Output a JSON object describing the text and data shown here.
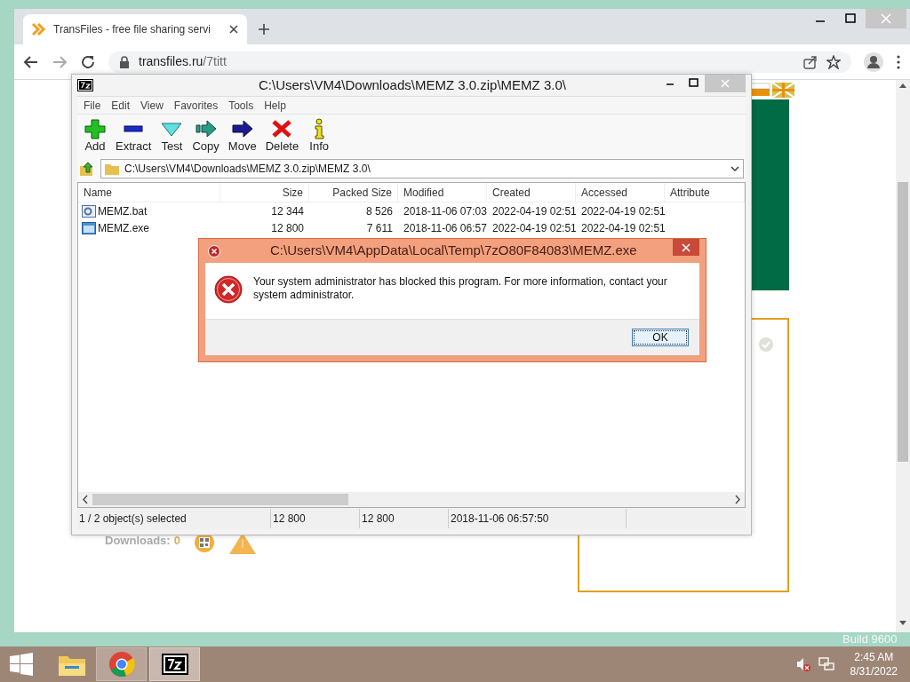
{
  "desktop": {
    "build_text": "Build 9600"
  },
  "browser": {
    "tab_title": "TransFiles - free file sharing servi",
    "url_host": "transfiles.ru",
    "url_path": "/7titt",
    "page": {
      "downloads_label": "Downloads:",
      "downloads_value": "0"
    }
  },
  "archive_window": {
    "title": "C:\\Users\\VM4\\Downloads\\MEMZ 3.0.zip\\MEMZ 3.0\\",
    "menu": [
      "File",
      "Edit",
      "View",
      "Favorites",
      "Tools",
      "Help"
    ],
    "toolbar": [
      {
        "kind": "add",
        "label": "Add"
      },
      {
        "kind": "extract",
        "label": "Extract"
      },
      {
        "kind": "test",
        "label": "Test"
      },
      {
        "kind": "copy",
        "label": "Copy"
      },
      {
        "kind": "move",
        "label": "Move"
      },
      {
        "kind": "delete",
        "label": "Delete"
      },
      {
        "kind": "info",
        "label": "Info"
      }
    ],
    "address": "C:\\Users\\VM4\\Downloads\\MEMZ 3.0.zip\\MEMZ 3.0\\",
    "columns": [
      "Name",
      "Size",
      "Packed Size",
      "Modified",
      "Created",
      "Accessed",
      "Attribute"
    ],
    "rows": [
      {
        "kind": "script",
        "cells": [
          "MEMZ.bat",
          "12 344",
          "8 526",
          "2018-11-06 07:03",
          "2022-04-19 02:51",
          "2022-04-19 02:51"
        ]
      },
      {
        "kind": "program",
        "cells": [
          "MEMZ.exe",
          "12 800",
          "7 611",
          "2018-11-06 06:57",
          "2022-04-19 02:51",
          "2022-04-19 02:51"
        ]
      }
    ],
    "status_bar": [
      "1 / 2 object(s) selected",
      "12 800",
      "12 800",
      "2018-11-06 06:57:50"
    ]
  },
  "dialog": {
    "title": "C:\\Users\\VM4\\AppData\\Local\\Temp\\7zO80F84083\\MEMZ.exe",
    "message": "Your system administrator has blocked this program. For more information, contact your system administrator.",
    "button": "OK"
  },
  "taskbar": {
    "time": "2:45 AM",
    "date": "8/31/2022"
  }
}
